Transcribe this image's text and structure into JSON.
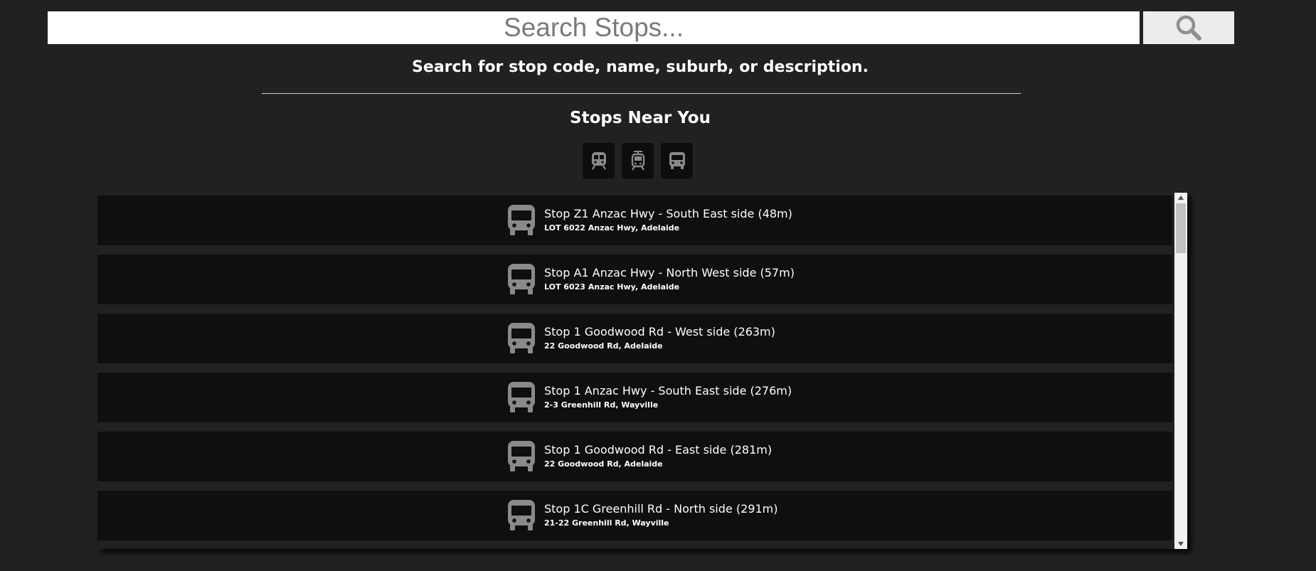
{
  "search": {
    "placeholder": "Search Stops...",
    "value": ""
  },
  "hint_text": "Search for stop code, name, suburb, or description.",
  "near_title": "Stops Near You",
  "modes": [
    {
      "name": "train",
      "icon": "train-icon"
    },
    {
      "name": "tram",
      "icon": "tram-icon"
    },
    {
      "name": "bus",
      "icon": "bus-icon"
    }
  ],
  "stops": [
    {
      "name": "Stop Z1 Anzac Hwy - South East side (48m)",
      "address": "LOT 6022 Anzac Hwy, Adelaide",
      "icon": "bus-icon"
    },
    {
      "name": "Stop A1 Anzac Hwy - North West side (57m)",
      "address": "LOT 6023 Anzac Hwy, Adelaide",
      "icon": "bus-icon"
    },
    {
      "name": "Stop 1 Goodwood Rd - West side (263m)",
      "address": "22 Goodwood Rd, Adelaide",
      "icon": "bus-icon"
    },
    {
      "name": "Stop 1 Anzac Hwy - South East side (276m)",
      "address": "2-3 Greenhill Rd, Wayville",
      "icon": "bus-icon"
    },
    {
      "name": "Stop 1 Goodwood Rd - East side (281m)",
      "address": "22 Goodwood Rd, Adelaide",
      "icon": "bus-icon"
    },
    {
      "name": "Stop 1C Greenhill Rd - North side (291m)",
      "address": "21-22 Greenhill Rd, Wayville",
      "icon": "bus-icon"
    }
  ],
  "colors": {
    "background": "#212121",
    "row_background": "#0f0f0f",
    "icon_gray": "#8a8a8a",
    "text": "#ffffff"
  }
}
